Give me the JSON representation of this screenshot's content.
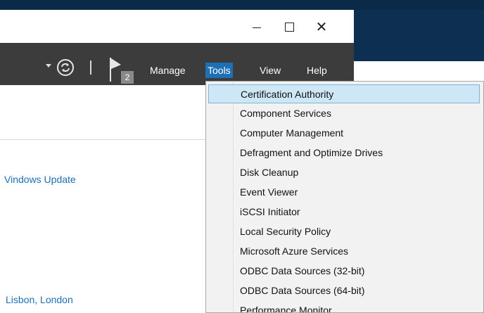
{
  "window": {
    "minimize": "–",
    "maximize": "☐",
    "close": "✕"
  },
  "toolbar": {
    "notification_count": "2",
    "menus": [
      "Manage",
      "Tools",
      "View",
      "Help"
    ],
    "active_menu": "Tools"
  },
  "body": {
    "windows_update": "Vindows Update",
    "timezone": "Lisbon, London"
  },
  "tools_menu": {
    "items": [
      "Certification Authority",
      "Component Services",
      "Computer Management",
      "Defragment and Optimize Drives",
      "Disk Cleanup",
      "Event Viewer",
      "iSCSI Initiator",
      "Local Security Policy",
      "Microsoft Azure Services",
      "ODBC Data Sources (32-bit)",
      "ODBC Data Sources (64-bit)",
      "Performance Monitor"
    ],
    "highlighted_index": 0
  },
  "colors": {
    "toolbar_bg": "#3c3c3c",
    "accent": "#1f6fb5",
    "menu_highlight": "#cde7f7"
  }
}
